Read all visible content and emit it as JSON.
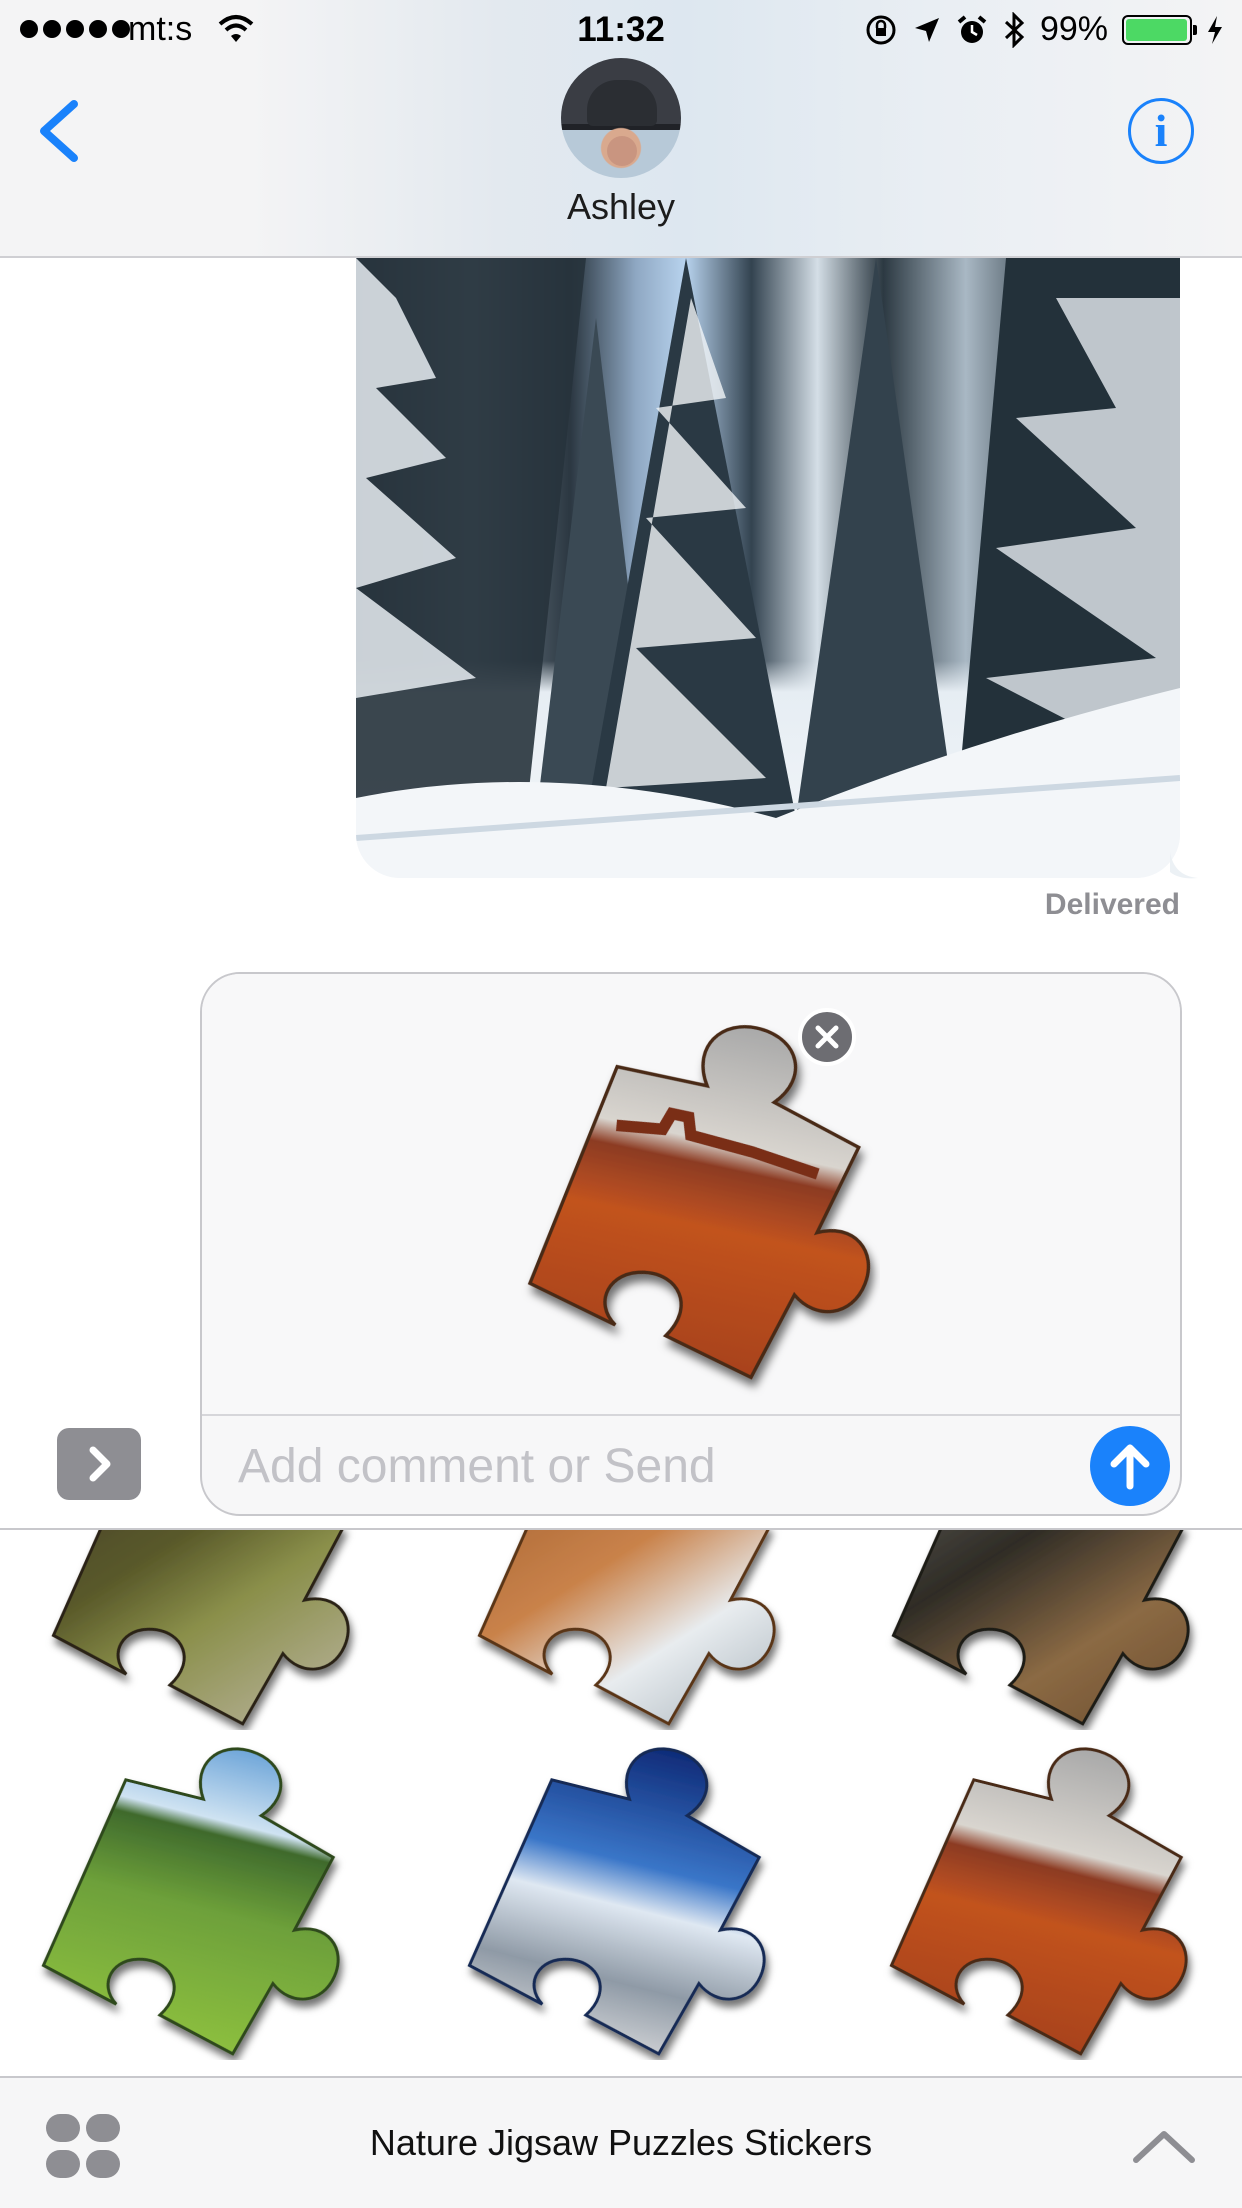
{
  "status_bar": {
    "carrier": "mt:s",
    "time": "11:32",
    "battery_percent": "99%",
    "battery_level": 0.99,
    "icons": [
      "signal-dots-icon",
      "wifi-icon",
      "rotation-lock-icon",
      "location-icon",
      "alarm-icon",
      "bluetooth-icon",
      "battery-icon",
      "charging-icon"
    ]
  },
  "header": {
    "contact_name": "Ashley",
    "info_label": "i",
    "back_icon": "chevron-left-icon"
  },
  "conversation": {
    "photo_message": {
      "description_icon": "photo-snowy-forest"
    },
    "delivery_status": "Delivered"
  },
  "compose": {
    "placeholder": "Add comment or Send",
    "value": "",
    "attached_sticker": "desert-mesa-puzzle-piece",
    "send_icon": "arrow-up-icon",
    "remove_icon": "close-icon",
    "expand_icon": "chevron-right-icon"
  },
  "sticker_drawer": {
    "app_title": "Nature Jigsaw Puzzles Stickers",
    "stickers": [
      {
        "name": "cave-rocks-puzzle-piece"
      },
      {
        "name": "sea-arch-puzzle-piece"
      },
      {
        "name": "forest-rocks-puzzle-piece"
      },
      {
        "name": "meadow-trees-puzzle-piece"
      },
      {
        "name": "blue-sky-mountain-puzzle-piece"
      },
      {
        "name": "desert-mesa-puzzle-piece"
      }
    ]
  },
  "colors": {
    "accent": "#1a82fb",
    "battery": "#4cd964",
    "muted_text": "#8e8e93",
    "placeholder": "#c2c2c7"
  }
}
